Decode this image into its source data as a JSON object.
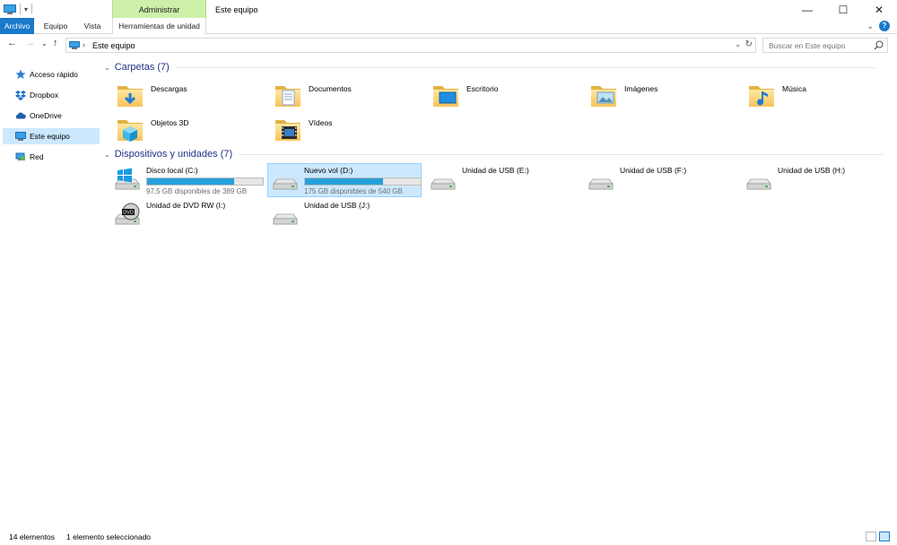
{
  "titlebar": {
    "quick_access_arrow": "▾",
    "context_header": "Administrar",
    "window_title": "Este equipo",
    "minimize": "—",
    "maximize": "☐",
    "close": "✕"
  },
  "ribbon": {
    "tabs": [
      "Archivo",
      "Equipo",
      "Vista",
      "Herramientas de unidad"
    ],
    "toggle": "⌄",
    "help": "?"
  },
  "address": {
    "back": "←",
    "forward": "→",
    "recent": "⌄",
    "up": "↑",
    "chevron": "›",
    "path": "Este equipo",
    "dropdown": "⌄",
    "refresh": "↻"
  },
  "search": {
    "placeholder": "Buscar en Este equipo"
  },
  "navpane": {
    "items": [
      {
        "label": "Acceso rápido",
        "icon": "star-icon"
      },
      {
        "label": "Dropbox",
        "icon": "dropbox-icon"
      },
      {
        "label": "OneDrive",
        "icon": "cloud-icon"
      },
      {
        "label": "Este equipo",
        "icon": "computer-icon"
      },
      {
        "label": "Red",
        "icon": "network-icon"
      }
    ]
  },
  "groups": {
    "folders_title": "Carpetas (7)",
    "devices_title": "Dispositivos y unidades (7)"
  },
  "folders": [
    {
      "label": "Descargas",
      "icon": "downloads-folder-icon"
    },
    {
      "label": "Documentos",
      "icon": "documents-folder-icon"
    },
    {
      "label": "Escritorio",
      "icon": "desktop-folder-icon"
    },
    {
      "label": "Imágenes",
      "icon": "pictures-folder-icon"
    },
    {
      "label": "Música",
      "icon": "music-folder-icon"
    },
    {
      "label": "Objetos 3D",
      "icon": "3d-objects-folder-icon"
    },
    {
      "label": "Vídeos",
      "icon": "videos-folder-icon"
    }
  ],
  "drives": [
    {
      "label": "Disco local (C:)",
      "free": "97,5 GB disponibles de 389 GB",
      "used_fraction": 0.75,
      "icon": "windows-drive-icon"
    },
    {
      "label": "Nuevo vol (D:)",
      "free": "175 GB disponibles de 540 GB",
      "used_fraction": 0.676,
      "icon": "hard-drive-icon"
    },
    {
      "label": "Unidad de USB (E:)",
      "icon": "usb-drive-icon"
    },
    {
      "label": "Unidad de USB (F:)",
      "icon": "usb-drive-icon"
    },
    {
      "label": "Unidad de USB (H:)",
      "icon": "usb-drive-icon"
    },
    {
      "label": "Unidad de DVD RW (I:)",
      "icon": "dvd-drive-icon"
    },
    {
      "label": "Unidad de USB (J:)",
      "icon": "usb-drive-icon"
    }
  ],
  "dvd_text": "DVD",
  "status": {
    "count": "14 elementos",
    "selection": "1 elemento seleccionado"
  },
  "colors": {
    "accent": "#1979ca",
    "selection": "#cce8ff",
    "context_tab": "#cdf0a9",
    "bar_fill": "#26a0da",
    "group_title": "#1e3287"
  }
}
